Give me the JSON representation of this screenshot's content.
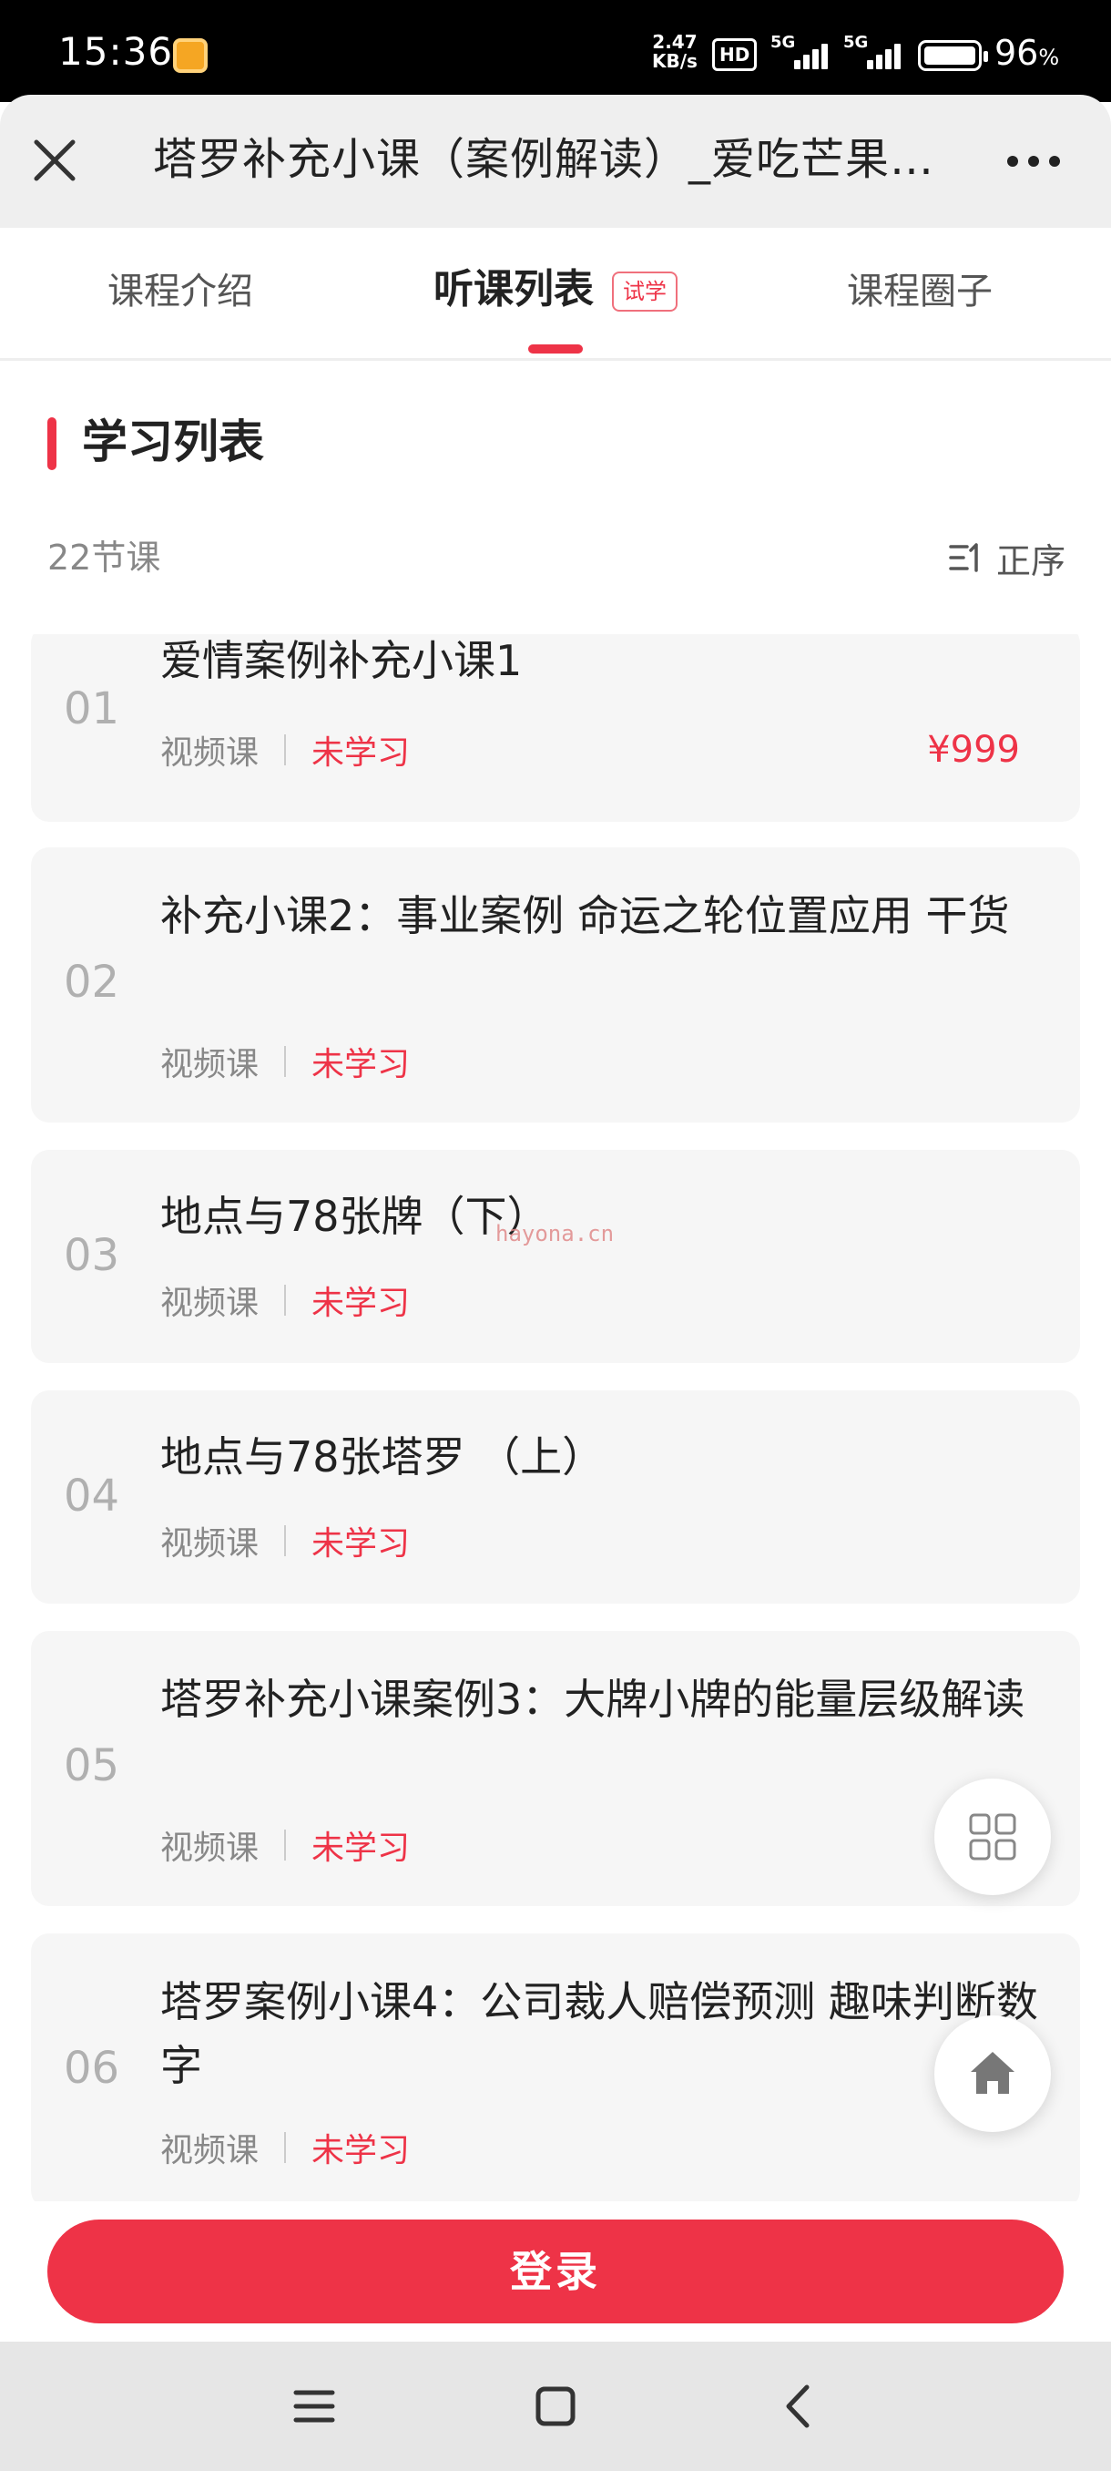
{
  "status_bar": {
    "time": "15:36",
    "net_speed_value": "2.47",
    "net_speed_unit": "KB/s",
    "hd_label": "HD",
    "signal_label_1": "5G",
    "signal_label_2": "5G",
    "battery_percent": "96",
    "battery_percent_sign": "%",
    "battery_level": 0.96
  },
  "header": {
    "title": "塔罗补充小课（案例解读）_爱吃芒果的塔罗师"
  },
  "tabs": [
    {
      "label": "课程介绍",
      "active": false
    },
    {
      "label": "听课列表",
      "active": true,
      "badge": "试学"
    },
    {
      "label": "课程圈子",
      "active": false
    }
  ],
  "section": {
    "title": "学习列表",
    "count": "22节课",
    "sort_label": "正序"
  },
  "lessons": [
    {
      "num": "01",
      "title": "爱情案例补充小课1",
      "type": "视频课",
      "status": "未学习",
      "price": "¥999"
    },
    {
      "num": "02",
      "title": "补充小课2：事业案例 命运之轮位置应用 干货",
      "type": "视频课",
      "status": "未学习"
    },
    {
      "num": "03",
      "title": "地点与78张牌（下）",
      "type": "视频课",
      "status": "未学习"
    },
    {
      "num": "04",
      "title": "地点与78张塔罗 （上）",
      "type": "视频课",
      "status": "未学习"
    },
    {
      "num": "05",
      "title": "塔罗补充小课案例3：大牌小牌的能量层级解读",
      "type": "视频课",
      "status": "未学习"
    },
    {
      "num": "06",
      "title": "塔罗案例小课4：公司裁人赔偿预测 趣味判断数字",
      "type": "视频课",
      "status": "未学习"
    }
  ],
  "watermark": "hayona.cn",
  "login_button": "登录",
  "colors": {
    "accent": "#ee3347",
    "muted_text": "#888888",
    "card_bg": "#f6f6f6"
  },
  "icons": {
    "close": "close-icon",
    "more": "more-icon",
    "sort": "sort-icon",
    "grid": "grid-icon",
    "home": "home-icon",
    "nav_menu": "menu-icon",
    "nav_home": "square-icon",
    "nav_back": "back-icon"
  }
}
